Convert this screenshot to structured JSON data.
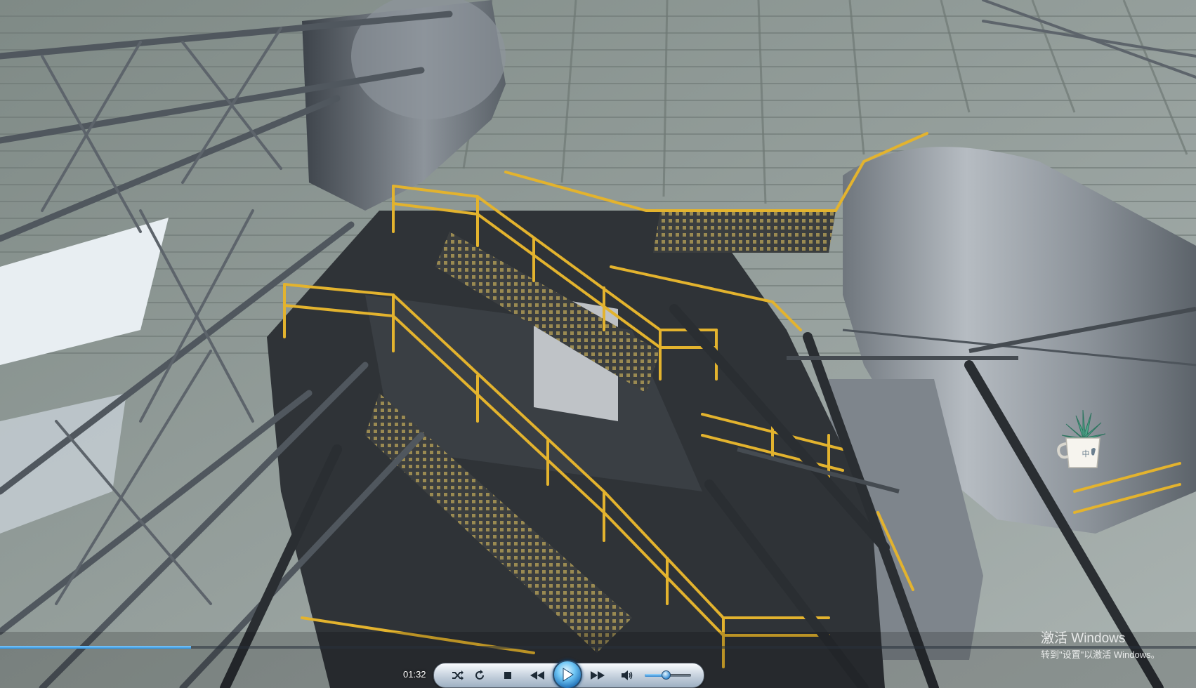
{
  "player": {
    "current_time": "01:32",
    "progress_fraction": 0.16,
    "volume_fraction": 0.45,
    "controls": [
      {
        "name": "shuffle-button",
        "icon": "shuffle-icon"
      },
      {
        "name": "repeat-button",
        "icon": "repeat-icon"
      },
      {
        "name": "stop-button",
        "icon": "stop-icon"
      },
      {
        "name": "previous-button",
        "icon": "rewind-icon"
      },
      {
        "name": "play-button",
        "icon": "play-icon"
      },
      {
        "name": "next-button",
        "icon": "fast-forward-icon"
      },
      {
        "name": "mute-button",
        "icon": "speaker-icon"
      }
    ],
    "accent_color": "#2f8fd8"
  },
  "watermark": {
    "title": "激活 Windows",
    "subtitle": "转到\"设置\"以激活 Windows。"
  },
  "ime": {
    "label": "中",
    "icon": "succulent-plant-mug-icon"
  },
  "video": {
    "scene_colors": {
      "railing": "#e3b32e",
      "steel": "#4a5057",
      "silo": "#8d949b",
      "roof": "#98a3a0"
    }
  }
}
